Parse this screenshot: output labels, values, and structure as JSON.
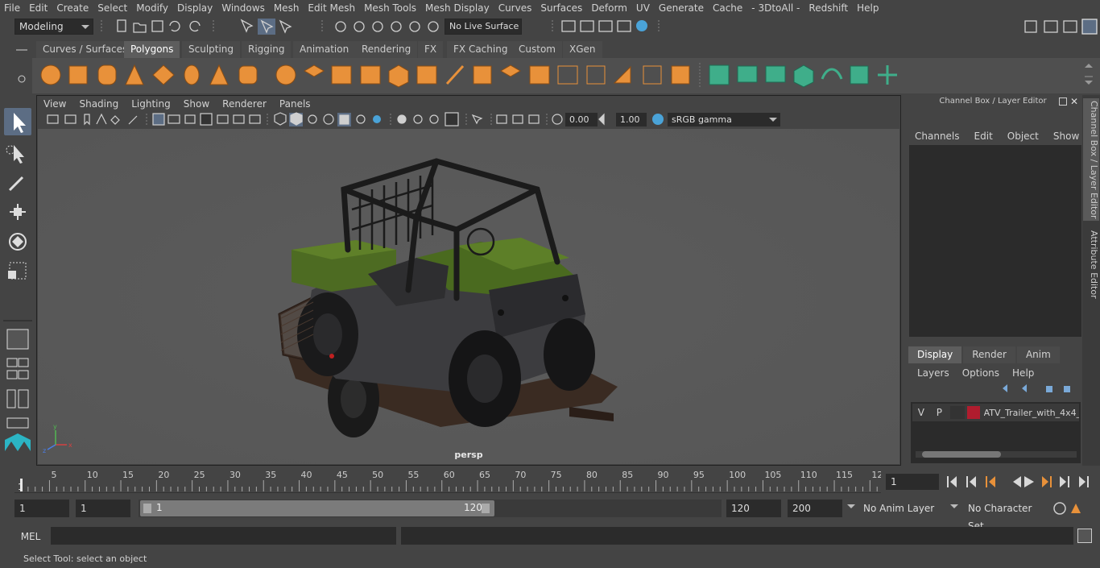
{
  "menubar": [
    "File",
    "Edit",
    "Create",
    "Select",
    "Modify",
    "Display",
    "Windows",
    "Mesh",
    "Edit Mesh",
    "Mesh Tools",
    "Mesh Display",
    "Curves",
    "Surfaces",
    "Deform",
    "UV",
    "Generate",
    "Cache",
    "- 3DtoAll -",
    "Redshift",
    "Help"
  ],
  "status": {
    "mode": "Modeling",
    "live_surface": "No Live Surface"
  },
  "shelf_tabs": [
    "Curves / Surfaces",
    "Polygons",
    "Sculpting",
    "Rigging",
    "Animation",
    "Rendering",
    "FX",
    "FX Caching",
    "Custom",
    "XGen"
  ],
  "shelf_active": "Polygons",
  "viewport": {
    "menu": [
      "View",
      "Shading",
      "Lighting",
      "Show",
      "Renderer",
      "Panels"
    ],
    "exposure": "0.00",
    "gamma": "1.00",
    "color_space": "sRGB gamma",
    "camera_label": "persp"
  },
  "channel_box": {
    "title": "Channel Box / Layer Editor",
    "menu": [
      "Channels",
      "Edit",
      "Object",
      "Show"
    ],
    "layer_tabs": [
      "Display",
      "Render",
      "Anim"
    ],
    "layer_menu": [
      "Layers",
      "Options",
      "Help"
    ],
    "layer": {
      "v": "V",
      "p": "P",
      "name": "ATV_Trailer_with_4x4_",
      "color": "#b01c2e"
    }
  },
  "side_tabs": [
    "Channel Box / Layer Editor",
    "Attribute Editor"
  ],
  "timeline": {
    "ticks": [
      "5",
      "10",
      "15",
      "20",
      "25",
      "30",
      "35",
      "40",
      "45",
      "50",
      "55",
      "60",
      "65",
      "70",
      "75",
      "80",
      "85",
      "90",
      "95",
      "100",
      "105",
      "110",
      "115",
      "12"
    ],
    "start_label": "1",
    "current_frame": "1"
  },
  "range": {
    "start": "1",
    "playback_start": "1",
    "slider_start": "1",
    "slider_end": "120",
    "playback_end": "120",
    "end": "200",
    "anim_layer": "No Anim Layer",
    "char_set": "No Character Set"
  },
  "command": {
    "label": "MEL"
  },
  "help_line": "Select Tool: select an object",
  "colors": {
    "accent": "#5c6d84",
    "shelf_orange": "#e8913a",
    "shelf_green": "#3fae8a"
  }
}
